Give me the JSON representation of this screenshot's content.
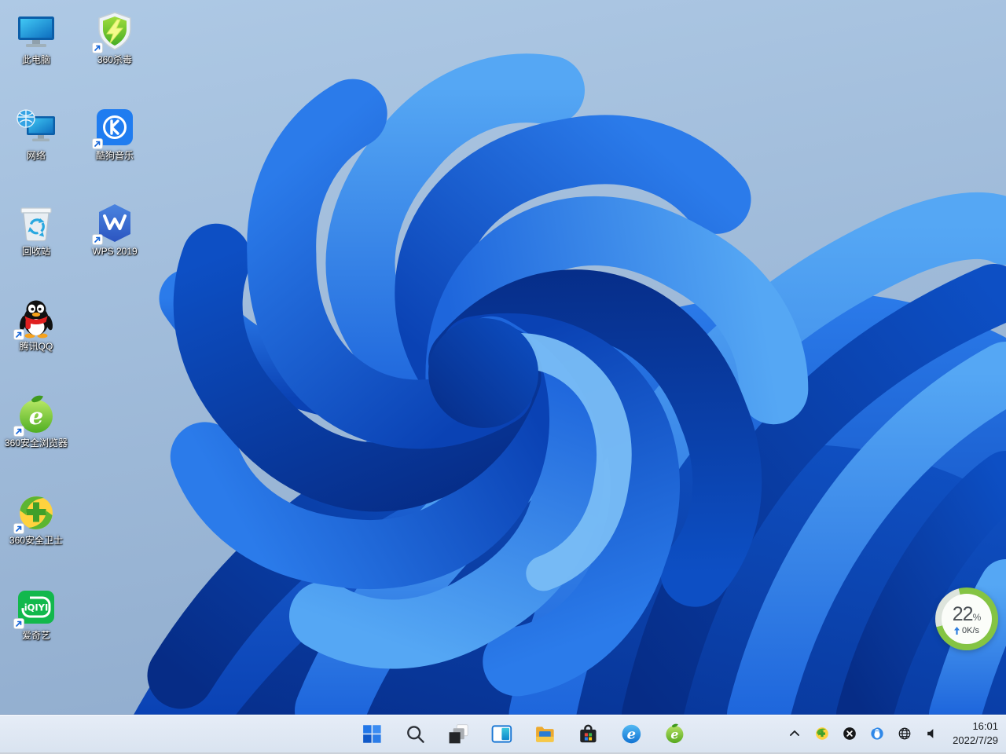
{
  "desktop": {
    "icons": [
      {
        "name": "this-pc",
        "label": "此电脑"
      },
      {
        "name": "360-antivirus",
        "label": "360杀毒"
      },
      {
        "name": "network",
        "label": "网络"
      },
      {
        "name": "kugou-music",
        "label": "酷狗音乐"
      },
      {
        "name": "recycle-bin",
        "label": "回收站"
      },
      {
        "name": "wps-2019",
        "label": "WPS 2019"
      },
      {
        "name": "tencent-qq",
        "label": "腾讯QQ"
      },
      {
        "name": "360-secure-browser",
        "label": "360安全浏览器"
      },
      {
        "name": "360-safeguard",
        "label": "360安全卫士"
      },
      {
        "name": "iqiyi",
        "label": "爱奇艺"
      }
    ]
  },
  "taskbar": {
    "buttons": [
      {
        "icon": "start-icon"
      },
      {
        "icon": "search-icon"
      },
      {
        "icon": "task-view-icon"
      },
      {
        "icon": "widgets-icon"
      },
      {
        "icon": "file-explorer-icon"
      },
      {
        "icon": "microsoft-store-icon"
      },
      {
        "icon": "internet-explorer-icon"
      },
      {
        "icon": "360-browser-icon"
      }
    ],
    "tray_icons": [
      "chevron-up-icon",
      "360-safeguard-tray-icon",
      "black-x-tray-icon",
      "qq-tray-icon",
      "network-globe-icon",
      "volume-icon"
    ],
    "clock": {
      "time": "16:01",
      "date": "2022/7/29"
    }
  },
  "speed_ball": {
    "percent": "22",
    "unit": "%",
    "speed": "0K/s"
  },
  "colors": {
    "desktop_bg_top": "#adc8e4",
    "desktop_bg_bottom": "#93afcf",
    "bloom_dark": "#0a42b4",
    "bloom_mid": "#1661d8",
    "bloom_light": "#55a7f4",
    "taskbar_bg": "#dfe8f4",
    "ball_ring_green": "#84c443"
  }
}
